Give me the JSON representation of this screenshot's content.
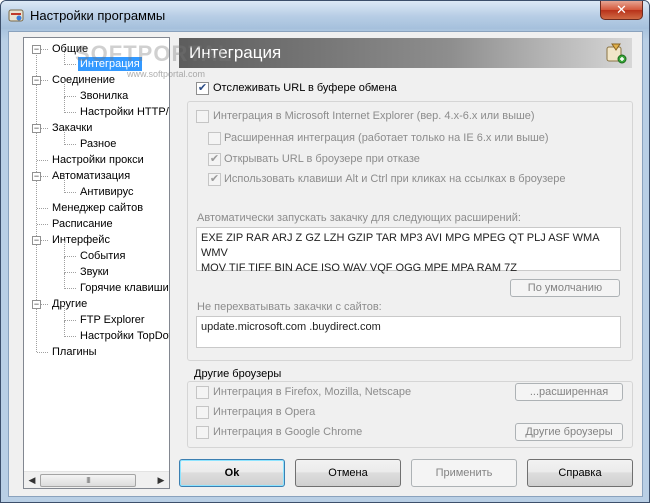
{
  "window": {
    "title": "Настройки программы",
    "close_glyph": "✕"
  },
  "tree": {
    "items": [
      {
        "label": "Общие"
      },
      {
        "label": "Интеграция"
      },
      {
        "label": "Соединение"
      },
      {
        "label": "Звонилка"
      },
      {
        "label": "Настройки HTTP/FTP"
      },
      {
        "label": "Закачки"
      },
      {
        "label": "Разное"
      },
      {
        "label": "Настройки прокси"
      },
      {
        "label": "Автоматизация"
      },
      {
        "label": "Антивирус"
      },
      {
        "label": "Менеджер сайтов"
      },
      {
        "label": "Расписание"
      },
      {
        "label": "Интерфейс"
      },
      {
        "label": "События"
      },
      {
        "label": "Звуки"
      },
      {
        "label": "Горячие клавиши"
      },
      {
        "label": "Другие"
      },
      {
        "label": "FTP Explorer"
      },
      {
        "label": "Настройки TopDownload"
      },
      {
        "label": "Плагины"
      }
    ],
    "scroll_grip": "III"
  },
  "watermark": {
    "text": "SOFTPORTAL",
    "sub": "www.softportal.com"
  },
  "section": {
    "title": "Интеграция"
  },
  "clipboard": {
    "label": "Отслеживать URL в буфере обмена",
    "checked": true
  },
  "ie": {
    "main_label": "Интеграция в Microsoft Internet Explorer (вер. 4.x-6.x или выше)",
    "advanced_label": "Расширенная интеграция (работает только на IE 6.x или выше)",
    "open_url_label": "Открывать URL в броузере при отказе",
    "alt_ctrl_label": "Использовать клавиши Alt и Ctrl при кликах на ссылках в броузере"
  },
  "extensions": {
    "label": "Автоматически запускать закачку для следующих расширений:",
    "line1": "EXE ZIP RAR ARJ Z GZ LZH GZIP TAR MP3 AVI MPG MPEG QT PLJ ASF WMA WMV",
    "line2": "MOV TIF TIFF BIN ACE ISO WAV VQF OGG MPE MPA RAM 7Z",
    "default_button": "По умолчанию"
  },
  "exclude": {
    "label": "Не перехватывать закачки с сайтов:",
    "value": "update.microsoft.com .buydirect.com"
  },
  "other_browsers": {
    "title": "Другие броузеры",
    "firefox": "Интеграция в Firefox, Mozilla, Netscape",
    "opera": "Интеграция в Opera",
    "chrome": "Интеграция в Google Chrome",
    "advanced_button": "...расширенная",
    "others_button": "Другие броузеры"
  },
  "footer": {
    "ok": "Ok",
    "cancel": "Отмена",
    "apply": "Применить",
    "help": "Справка"
  },
  "colors": {
    "selection": "#3399ff",
    "header_dark": "#5d5d5d",
    "disabled_text": "#8c8c8c"
  }
}
